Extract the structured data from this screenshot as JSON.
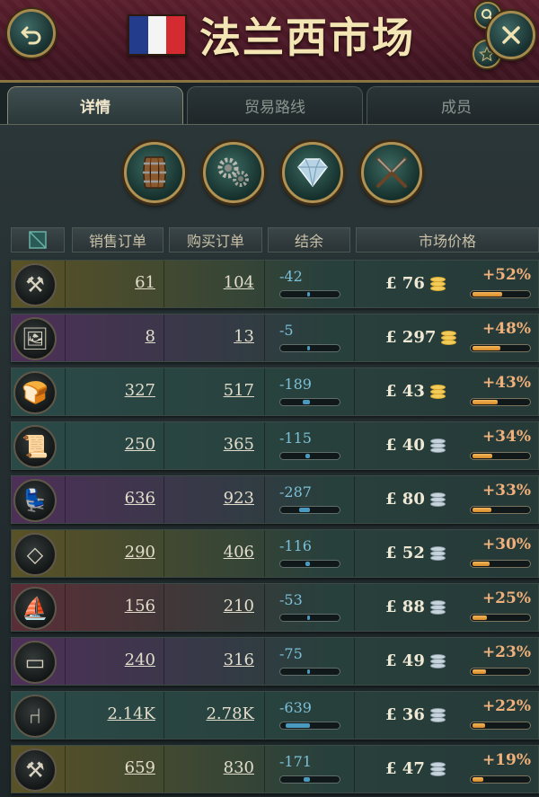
{
  "header": {
    "title": "法兰西市场",
    "flag_colors": [
      "#233c8c",
      "#f4f4f4",
      "#d42a32"
    ]
  },
  "tabs": [
    {
      "label": "详情",
      "active": true
    },
    {
      "label": "贸易路线",
      "active": false
    },
    {
      "label": "成员",
      "active": false
    }
  ],
  "categories": [
    "barrel-icon",
    "gears-icon",
    "diamond-icon",
    "crossed-rifles-icon"
  ],
  "columns": {
    "sell": "销售订单",
    "buy": "购买订单",
    "balance": "结余",
    "price": "市场价格"
  },
  "rows": [
    {
      "icon": "tools-bundle-icon",
      "sell": "61",
      "buy": "104",
      "balance": "-42",
      "price": "£ 76",
      "coin": "gold",
      "change": "+52%",
      "change_level": 0.52,
      "tint": "#5a5226"
    },
    {
      "icon": "painting-icon",
      "sell": "8",
      "buy": "13",
      "balance": "-5",
      "price": "£ 297",
      "coin": "gold",
      "change": "+48%",
      "change_level": 0.48,
      "tint": "#4e2f58"
    },
    {
      "icon": "groceries-icon",
      "sell": "327",
      "buy": "517",
      "balance": "-189",
      "price": "£ 43",
      "coin": "gold",
      "change": "+43%",
      "change_level": 0.43,
      "tint": "#2a4a48"
    },
    {
      "icon": "paper-icon",
      "sell": "250",
      "buy": "365",
      "balance": "-115",
      "price": "£ 40",
      "coin": "silver",
      "change": "+34%",
      "change_level": 0.34,
      "tint": "#2a4a48"
    },
    {
      "icon": "armchair-icon",
      "sell": "636",
      "buy": "923",
      "balance": "-287",
      "price": "£ 80",
      "coin": "silver",
      "change": "+33%",
      "change_level": 0.33,
      "tint": "#4e2f58"
    },
    {
      "icon": "glass-icon",
      "sell": "290",
      "buy": "406",
      "balance": "-116",
      "price": "£ 52",
      "coin": "silver",
      "change": "+30%",
      "change_level": 0.3,
      "tint": "#5a5226"
    },
    {
      "icon": "sailing-ship-icon",
      "sell": "156",
      "buy": "210",
      "balance": "-53",
      "price": "£ 88",
      "coin": "silver",
      "change": "+25%",
      "change_level": 0.25,
      "tint": "#5a2e36"
    },
    {
      "icon": "cigar-box-icon",
      "sell": "240",
      "buy": "316",
      "balance": "-75",
      "price": "£ 49",
      "coin": "silver",
      "change": "+23%",
      "change_level": 0.23,
      "tint": "#4e2f58"
    },
    {
      "icon": "chair-icon",
      "sell": "2.14K",
      "buy": "2.78K",
      "balance": "-639",
      "price": "£ 36",
      "coin": "silver",
      "change": "+22%",
      "change_level": 0.22,
      "tint": "#2a4a48"
    },
    {
      "icon": "tools-icon",
      "sell": "659",
      "buy": "830",
      "balance": "-171",
      "price": "£ 47",
      "coin": "silver",
      "change": "+19%",
      "change_level": 0.19,
      "tint": "#5a5226"
    }
  ]
}
